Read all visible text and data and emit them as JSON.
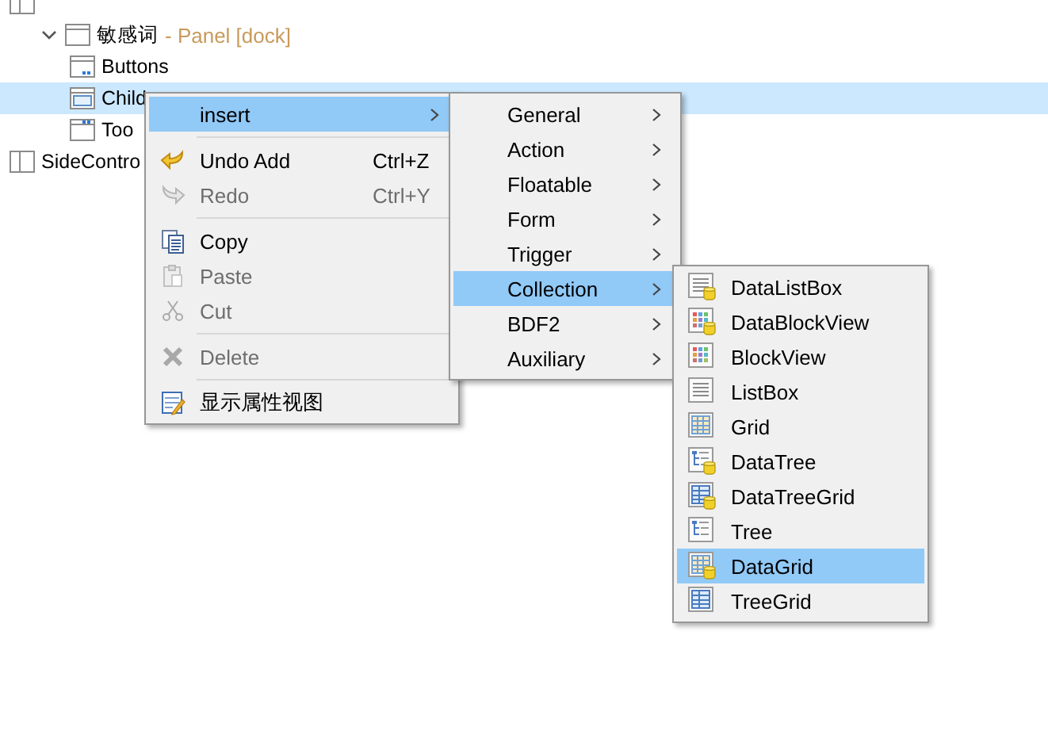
{
  "tree": [
    {
      "kind": "split",
      "selected": false,
      "children": [
        {
          "label": "敏感词",
          "suffix": "- Panel [dock]",
          "kind": "window",
          "expanded": true,
          "selected": false,
          "children": [
            {
              "label": "Buttons",
              "kind": "buttons",
              "selected": false
            },
            {
              "label": "Child",
              "kind": "children",
              "selected": true
            },
            {
              "label": "Too",
              "kind": "toolbar",
              "selected": false
            }
          ]
        }
      ]
    },
    {
      "label": "SideContro",
      "kind": "split",
      "selected": false
    }
  ],
  "context_menu": [
    {
      "kind": "submenu",
      "label": "insert",
      "selected": true,
      "disabled": false
    },
    {
      "kind": "separator"
    },
    {
      "kind": "undo",
      "label": "Undo Add",
      "shortcut": "Ctrl+Z",
      "selected": false,
      "disabled": false
    },
    {
      "kind": "redo",
      "label": "Redo",
      "shortcut": "Ctrl+Y",
      "selected": false,
      "disabled": true
    },
    {
      "kind": "separator"
    },
    {
      "kind": "copy",
      "label": "Copy",
      "selected": false,
      "disabled": false
    },
    {
      "kind": "paste",
      "label": "Paste",
      "selected": false,
      "disabled": true
    },
    {
      "kind": "cut",
      "label": "Cut",
      "selected": false,
      "disabled": true
    },
    {
      "kind": "separator"
    },
    {
      "kind": "delete",
      "label": "Delete",
      "selected": false,
      "disabled": true
    },
    {
      "kind": "separator"
    },
    {
      "kind": "properties",
      "label": "显示属性视图",
      "selected": false,
      "disabled": false
    }
  ],
  "insert_menu": [
    {
      "label": "General",
      "selected": false
    },
    {
      "label": "Action",
      "selected": false
    },
    {
      "label": "Floatable",
      "selected": false
    },
    {
      "label": "Form",
      "selected": false
    },
    {
      "label": "Trigger",
      "selected": false
    },
    {
      "label": "Collection",
      "selected": true
    },
    {
      "label": "BDF2",
      "selected": false
    },
    {
      "label": "Auxiliary",
      "selected": false
    }
  ],
  "collection_menu": [
    {
      "label": "DataListBox",
      "kind": "list",
      "data": true,
      "selected": false
    },
    {
      "label": "DataBlockView",
      "kind": "blocks",
      "data": true,
      "selected": false
    },
    {
      "label": "BlockView",
      "kind": "blocks",
      "data": false,
      "selected": false
    },
    {
      "label": "ListBox",
      "kind": "list",
      "data": false,
      "selected": false
    },
    {
      "label": "Grid",
      "kind": "grid",
      "data": false,
      "selected": false
    },
    {
      "label": "DataTree",
      "kind": "tree",
      "data": true,
      "selected": false
    },
    {
      "label": "DataTreeGrid",
      "kind": "treegrid",
      "data": true,
      "selected": false
    },
    {
      "label": "Tree",
      "kind": "tree",
      "data": false,
      "selected": false
    },
    {
      "label": "DataGrid",
      "kind": "grid",
      "data": true,
      "selected": true
    },
    {
      "label": "TreeGrid",
      "kind": "treegrid",
      "data": false,
      "selected": false
    }
  ]
}
